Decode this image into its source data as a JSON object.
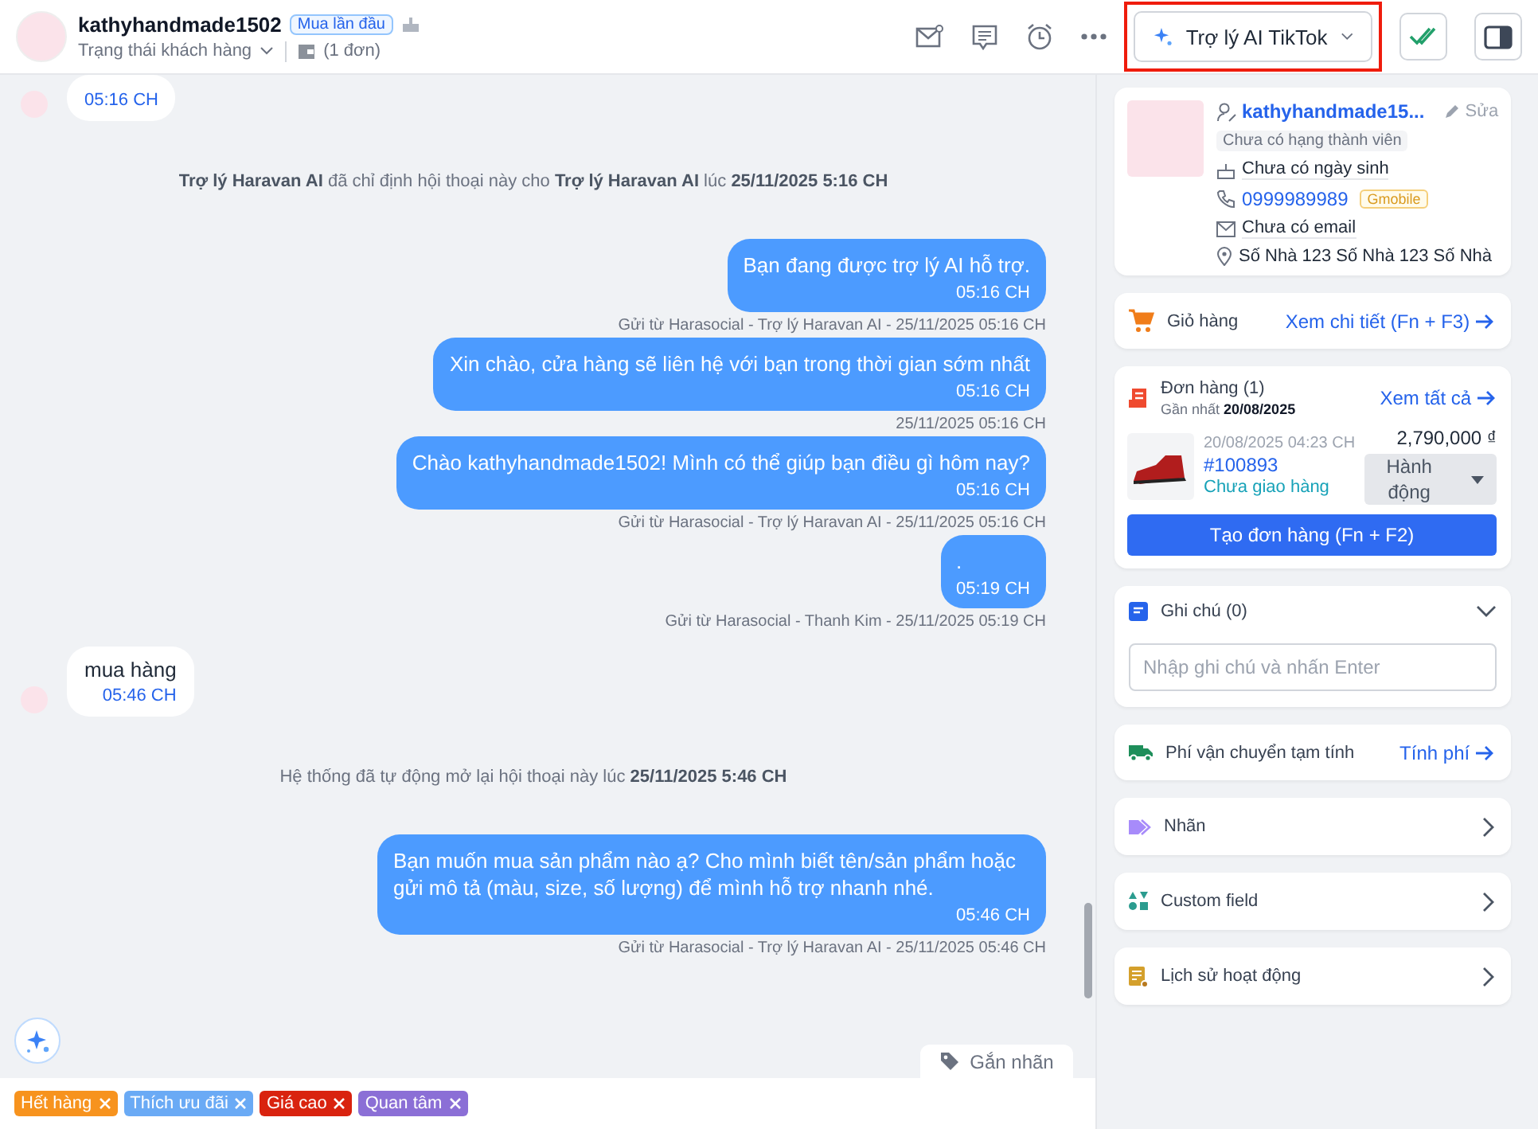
{
  "header": {
    "name": "kathyhandmade1502",
    "badge": "Mua lần đầu",
    "status_label": "Trạng thái khách hàng",
    "order_count": "(1 đơn)",
    "assistant_button": "Trợ lý AI TikTok",
    "assistant_highlighted": true
  },
  "messages": [
    {
      "kind": "incoming",
      "time": "05:16 CH"
    },
    {
      "kind": "system",
      "text": "**Trợ lý Haravan AI** đã chỉ định hội thoại này cho **Trợ lý Haravan AI** lúc **25/11/2025 5:16 CH**"
    },
    {
      "kind": "outgoing",
      "text": "Bạn đang được trợ lý AI hỗ trợ.",
      "time": "05:16 CH",
      "meta": "Gửi từ Harasocial - Trợ lý Haravan AI - 25/11/2025 05:16 CH"
    },
    {
      "kind": "outgoing",
      "text": "Xin chào, cửa hàng sẽ liên hệ với bạn trong thời gian sớm nhất",
      "time": "05:16 CH",
      "meta": "25/11/2025 05:16 CH"
    },
    {
      "kind": "outgoing",
      "text": "Chào kathyhandmade1502! Mình có thể giúp bạn điều gì hôm nay?",
      "time": "05:16 CH",
      "meta": "Gửi từ Harasocial - Trợ lý Haravan AI - 25/11/2025 05:16 CH"
    },
    {
      "kind": "outgoing",
      "text": ".",
      "time": "05:19 CH",
      "meta": "Gửi từ Harasocial - Thanh Kim - 25/11/2025 05:19 CH"
    },
    {
      "kind": "incoming",
      "text": "mua hàng",
      "time": "05:46 CH"
    },
    {
      "kind": "system",
      "text": "Hệ thống đã tự động mở lại hội thoại này lúc **25/11/2025 5:46 CH**"
    },
    {
      "kind": "outgoing",
      "text": "Bạn muốn mua sản phẩm nào ạ? Cho mình biết tên/sản phẩm hoặc gửi mô tả (màu, size, số lượng) để mình hỗ trợ nhanh nhé.",
      "time": "05:46 CH",
      "meta": "Gửi từ Harasocial - Trợ lý Haravan AI - 25/11/2025 05:46 CH"
    }
  ],
  "tag_button": "Gắn nhãn",
  "tags": [
    {
      "label": "Hết hàng",
      "color": "#f7931e"
    },
    {
      "label": "Thích ưu đãi",
      "color": "#6aaaf5"
    },
    {
      "label": "Giá cao",
      "color": "#d9230f"
    },
    {
      "label": "Quan tâm",
      "color": "#8b6fd6"
    }
  ],
  "customer": {
    "name": "kathyhandmade15...",
    "edit": "Sửa",
    "rank": "Chưa có hạng thành viên",
    "birthday": "Chưa có ngày sinh",
    "phone": "0999989989",
    "carrier": "Gmobile",
    "email": "Chưa có email",
    "address": "Số Nhà 123 Số Nhà 123 Số Nhà"
  },
  "cart": {
    "title": "Giỏ hàng",
    "link": "Xem chi tiết (Fn + F3)"
  },
  "orders": {
    "title": "Đơn hàng (1)",
    "latest": "Gần nhất **20/08/2025**",
    "link": "Xem tất cả",
    "item": {
      "date": "20/08/2025 04:23 CH",
      "code": "#100893",
      "status": "Chưa giao hàng",
      "price": "2,790,000 ₫",
      "action": "Hành động"
    },
    "create_button": "Tạo đơn hàng (Fn + F2)"
  },
  "notes": {
    "title": "Ghi chú (0)",
    "placeholder": "Nhập ghi chú và nhấn Enter",
    "expanded": true
  },
  "shipping": {
    "title": "Phí vận chuyển tạm tính",
    "link": "Tính phí"
  },
  "sections": [
    {
      "kind": "label",
      "title": "Nhãn"
    },
    {
      "kind": "custom",
      "title": "Custom field"
    },
    {
      "kind": "history",
      "title": "Lịch sử hoạt động"
    }
  ]
}
